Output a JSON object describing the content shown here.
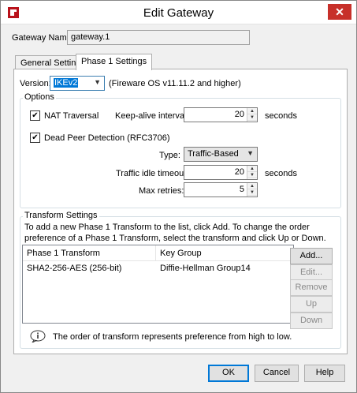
{
  "window": {
    "title": "Edit Gateway",
    "close_glyph": "✕"
  },
  "gateway": {
    "name_label": "Gateway Name:",
    "name_value": "gateway.1"
  },
  "tabs": [
    {
      "label": "General Settings"
    },
    {
      "label": "Phase 1 Settings"
    }
  ],
  "phase1": {
    "version_label": "Version:",
    "version_value": "IKEv2",
    "version_note": "(Fireware OS v11.11.2 and higher)",
    "options_title": "Options",
    "nat_traversal_label": "NAT Traversal",
    "nat_traversal_checked": true,
    "keepalive_label": "Keep-alive interval:",
    "keepalive_value": "20",
    "keepalive_unit": "seconds",
    "dpd_label": "Dead Peer Detection (RFC3706)",
    "dpd_checked": true,
    "type_label": "Type:",
    "type_value": "Traffic-Based",
    "idle_timeout_label": "Traffic idle timeout:",
    "idle_timeout_value": "20",
    "idle_timeout_unit": "seconds",
    "max_retries_label": "Max retries:",
    "max_retries_value": "5"
  },
  "transform": {
    "title": "Transform Settings",
    "description": "To add a new Phase 1 Transform to the list, click Add. To change the order preference of a Phase 1 Transform, select the transform and click Up or Down.",
    "columns": [
      "Phase 1 Transform",
      "Key Group"
    ],
    "rows": [
      {
        "transform": "SHA2-256-AES (256-bit)",
        "key_group": "Diffie-Hellman Group14"
      }
    ],
    "buttons": {
      "add": "Add...",
      "edit": "Edit...",
      "remove": "Remove",
      "up": "Up",
      "down": "Down"
    },
    "note": "The order of transform represents preference from high to low."
  },
  "footer": {
    "ok": "OK",
    "cancel": "Cancel",
    "help": "Help"
  },
  "colors": {
    "accent": "#0078d7",
    "close_button": "#c7302a"
  }
}
